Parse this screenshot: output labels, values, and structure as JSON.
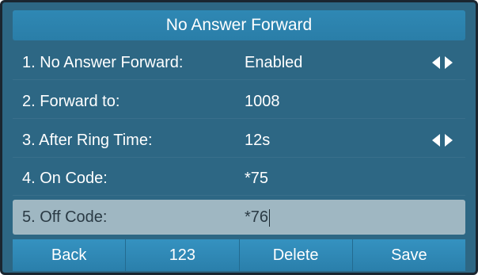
{
  "title": "No Answer Forward",
  "rows": [
    {
      "label": "1. No Answer Forward:",
      "value": "Enabled"
    },
    {
      "label": "2. Forward to:",
      "value": "1008"
    },
    {
      "label": "3. After Ring Time:",
      "value": "12s"
    },
    {
      "label": "4. On Code:",
      "value": "*75"
    },
    {
      "label": "5. Off Code:",
      "value": "*76"
    }
  ],
  "softkeys": [
    "Back",
    "123",
    "Delete",
    "Save"
  ],
  "colors": {
    "background": "#2d6784",
    "title_bar": "#2a7ea8",
    "selected_row": "#9fb7c2",
    "softkey": "#2a7fab"
  },
  "icons": {
    "left_arrow": "left-arrow-icon",
    "right_arrow": "right-arrow-icon"
  }
}
